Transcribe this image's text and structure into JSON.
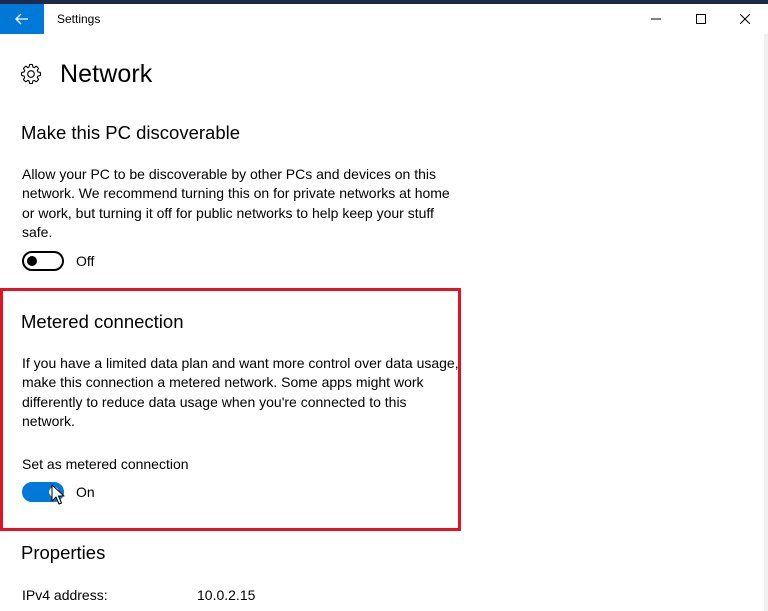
{
  "window": {
    "title": "Settings"
  },
  "page": {
    "title": "Network"
  },
  "discoverable": {
    "title": "Make this PC discoverable",
    "description": "Allow your PC to be discoverable by other PCs and devices on this network. We recommend turning this on for private networks at home or work, but turning it off for public networks to help keep your stuff safe.",
    "toggle_state": "Off"
  },
  "metered": {
    "title": "Metered connection",
    "description": "If you have a limited data plan and want more control over data usage, make this connection a metered network. Some apps might work differently to reduce data usage when you're connected to this network.",
    "setting_label": "Set as metered connection",
    "toggle_state": "On"
  },
  "properties": {
    "title": "Properties",
    "ipv4_label": "IPv4 address:",
    "ipv4_value": "10.0.2.15"
  },
  "colors": {
    "accent": "#0078d7",
    "highlight": "#e81123"
  },
  "icons": {
    "back": "arrow-left-icon",
    "minimize": "minimize-icon",
    "maximize": "maximize-icon",
    "close": "close-icon",
    "settings": "gear-icon"
  }
}
